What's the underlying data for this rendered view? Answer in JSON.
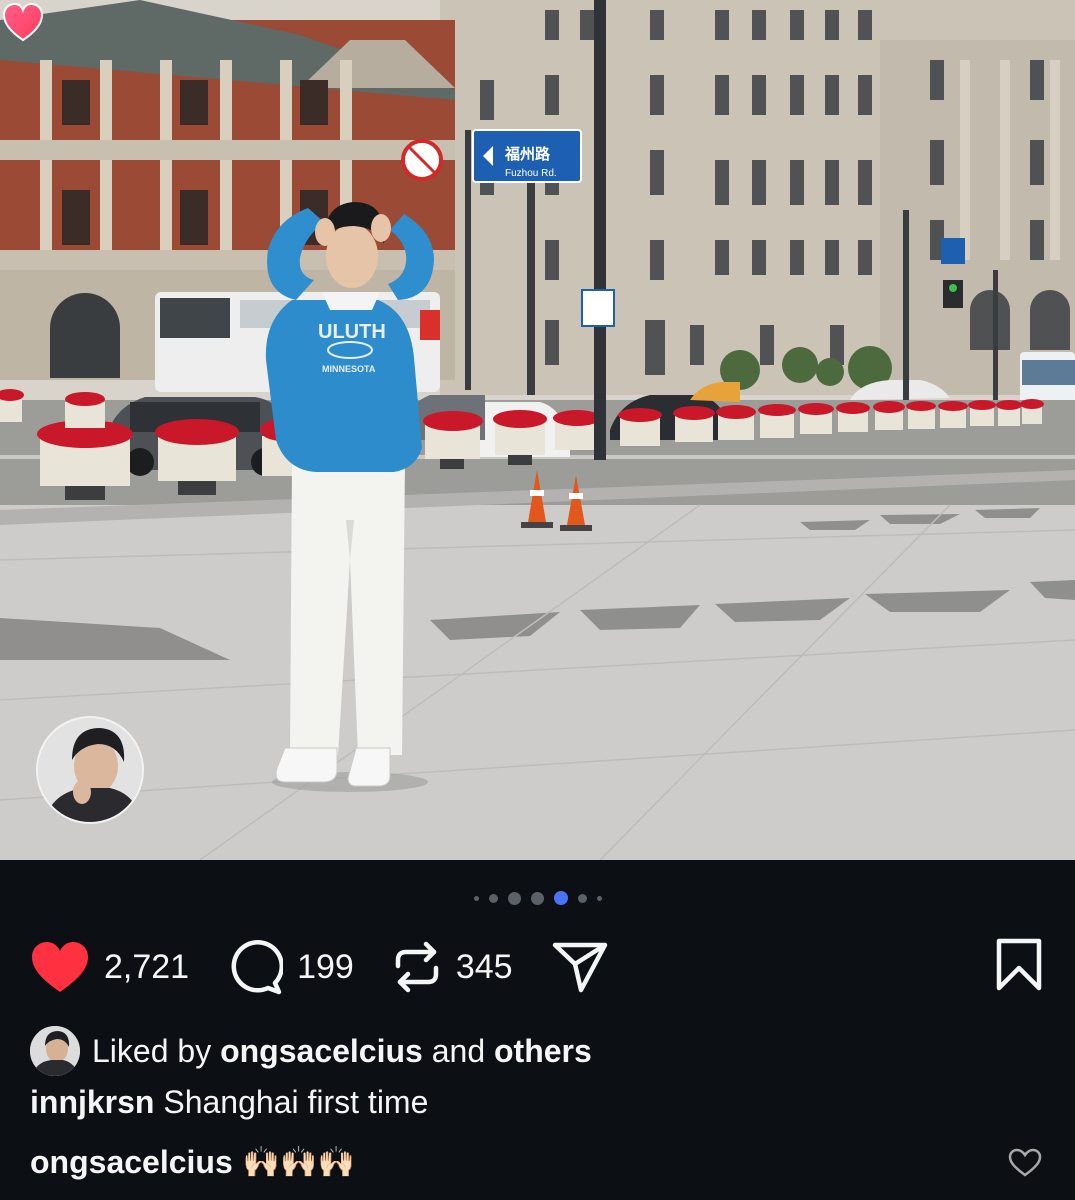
{
  "post": {
    "image_alt": "Man in blue sweatshirt and white pants standing in a paved plaza in Shanghai",
    "sign_text": "福州路",
    "sign_sub": "Fuzhou Rd.",
    "shirt_text": "MINNESOTA",
    "carousel": {
      "count": 7,
      "active_index": 4
    }
  },
  "actions": {
    "likes": "2,721",
    "comments": "199",
    "reposts": "345"
  },
  "liked_by": {
    "prefix": "Liked by",
    "user": "ongsacelcius",
    "middle": "and",
    "others": "others"
  },
  "caption": {
    "user": "innjkrsn",
    "text": "Shanghai first time"
  },
  "comment": {
    "user": "ongsacelcius",
    "emoji": "🙌🏻🙌🏻🙌🏻"
  },
  "colors": {
    "background": "#0c1014",
    "like": "#ff3040",
    "active_dot": "#4a73f5"
  }
}
